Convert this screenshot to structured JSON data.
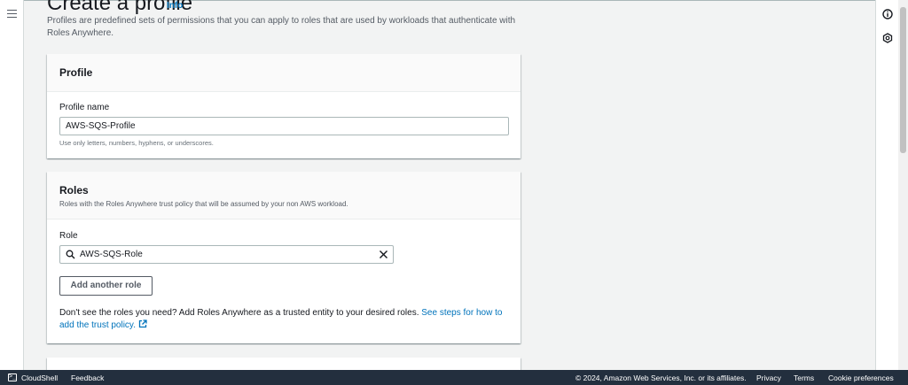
{
  "page": {
    "title": "Create a profile",
    "info_label": "Info",
    "description": "Profiles are predefined sets of permissions that you can apply to roles that are used by workloads that authenticate with Roles Anywhere."
  },
  "profile_panel": {
    "title": "Profile",
    "name_label": "Profile name",
    "name_value": "AWS-SQS-Profile",
    "name_constraint": "Use only letters, numbers, hyphens, or underscores."
  },
  "roles_panel": {
    "title": "Roles",
    "subtitle": "Roles with the Roles Anywhere trust policy that will be assumed by your non AWS workload.",
    "role_label": "Role",
    "role_value": "AWS-SQS-Role",
    "add_button": "Add another role",
    "hint_text": "Don't see the roles you need? Add Roles Anywhere as a trusted entity to your desired roles. ",
    "hint_link": "See steps for how to add the trust policy."
  },
  "footer": {
    "cloudshell": "CloudShell",
    "feedback": "Feedback",
    "copyright": "© 2024, Amazon Web Services, Inc. or its affiliates.",
    "privacy": "Privacy",
    "terms": "Terms",
    "cookie": "Cookie preferences"
  },
  "icons": {
    "menu": "hamburger-menu-icon",
    "info": "info-circle-icon",
    "notifications": "shield-settings-icon",
    "search": "search-icon",
    "clear": "close-icon",
    "external": "external-link-icon",
    "cloudshell": "terminal-icon"
  },
  "colors": {
    "link": "#0073bb",
    "footer_bg": "#232f3e",
    "page_bg": "#f2f3f3"
  }
}
